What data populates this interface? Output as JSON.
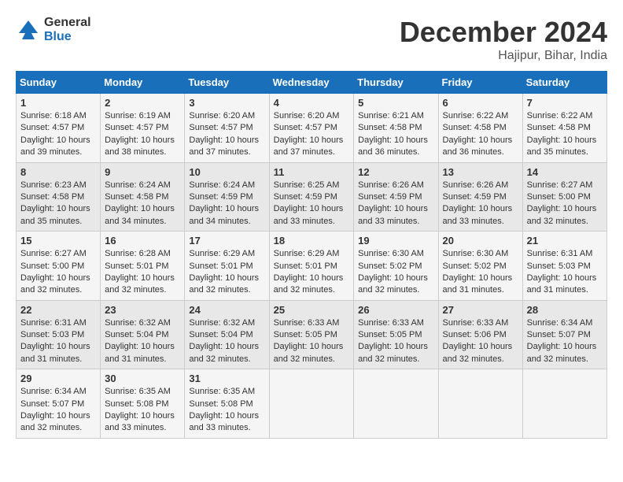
{
  "header": {
    "logo_general": "General",
    "logo_blue": "Blue",
    "main_title": "December 2024",
    "subtitle": "Hajipur, Bihar, India"
  },
  "weekdays": [
    "Sunday",
    "Monday",
    "Tuesday",
    "Wednesday",
    "Thursday",
    "Friday",
    "Saturday"
  ],
  "weeks": [
    [
      {
        "day": "1",
        "sunrise": "6:18 AM",
        "sunset": "4:57 PM",
        "daylight": "10 hours and 39 minutes."
      },
      {
        "day": "2",
        "sunrise": "6:19 AM",
        "sunset": "4:57 PM",
        "daylight": "10 hours and 38 minutes."
      },
      {
        "day": "3",
        "sunrise": "6:20 AM",
        "sunset": "4:57 PM",
        "daylight": "10 hours and 37 minutes."
      },
      {
        "day": "4",
        "sunrise": "6:20 AM",
        "sunset": "4:57 PM",
        "daylight": "10 hours and 37 minutes."
      },
      {
        "day": "5",
        "sunrise": "6:21 AM",
        "sunset": "4:58 PM",
        "daylight": "10 hours and 36 minutes."
      },
      {
        "day": "6",
        "sunrise": "6:22 AM",
        "sunset": "4:58 PM",
        "daylight": "10 hours and 36 minutes."
      },
      {
        "day": "7",
        "sunrise": "6:22 AM",
        "sunset": "4:58 PM",
        "daylight": "10 hours and 35 minutes."
      }
    ],
    [
      {
        "day": "8",
        "sunrise": "6:23 AM",
        "sunset": "4:58 PM",
        "daylight": "10 hours and 35 minutes."
      },
      {
        "day": "9",
        "sunrise": "6:24 AM",
        "sunset": "4:58 PM",
        "daylight": "10 hours and 34 minutes."
      },
      {
        "day": "10",
        "sunrise": "6:24 AM",
        "sunset": "4:59 PM",
        "daylight": "10 hours and 34 minutes."
      },
      {
        "day": "11",
        "sunrise": "6:25 AM",
        "sunset": "4:59 PM",
        "daylight": "10 hours and 33 minutes."
      },
      {
        "day": "12",
        "sunrise": "6:26 AM",
        "sunset": "4:59 PM",
        "daylight": "10 hours and 33 minutes."
      },
      {
        "day": "13",
        "sunrise": "6:26 AM",
        "sunset": "4:59 PM",
        "daylight": "10 hours and 33 minutes."
      },
      {
        "day": "14",
        "sunrise": "6:27 AM",
        "sunset": "5:00 PM",
        "daylight": "10 hours and 32 minutes."
      }
    ],
    [
      {
        "day": "15",
        "sunrise": "6:27 AM",
        "sunset": "5:00 PM",
        "daylight": "10 hours and 32 minutes."
      },
      {
        "day": "16",
        "sunrise": "6:28 AM",
        "sunset": "5:01 PM",
        "daylight": "10 hours and 32 minutes."
      },
      {
        "day": "17",
        "sunrise": "6:29 AM",
        "sunset": "5:01 PM",
        "daylight": "10 hours and 32 minutes."
      },
      {
        "day": "18",
        "sunrise": "6:29 AM",
        "sunset": "5:01 PM",
        "daylight": "10 hours and 32 minutes."
      },
      {
        "day": "19",
        "sunrise": "6:30 AM",
        "sunset": "5:02 PM",
        "daylight": "10 hours and 32 minutes."
      },
      {
        "day": "20",
        "sunrise": "6:30 AM",
        "sunset": "5:02 PM",
        "daylight": "10 hours and 31 minutes."
      },
      {
        "day": "21",
        "sunrise": "6:31 AM",
        "sunset": "5:03 PM",
        "daylight": "10 hours and 31 minutes."
      }
    ],
    [
      {
        "day": "22",
        "sunrise": "6:31 AM",
        "sunset": "5:03 PM",
        "daylight": "10 hours and 31 minutes."
      },
      {
        "day": "23",
        "sunrise": "6:32 AM",
        "sunset": "5:04 PM",
        "daylight": "10 hours and 31 minutes."
      },
      {
        "day": "24",
        "sunrise": "6:32 AM",
        "sunset": "5:04 PM",
        "daylight": "10 hours and 32 minutes."
      },
      {
        "day": "25",
        "sunrise": "6:33 AM",
        "sunset": "5:05 PM",
        "daylight": "10 hours and 32 minutes."
      },
      {
        "day": "26",
        "sunrise": "6:33 AM",
        "sunset": "5:05 PM",
        "daylight": "10 hours and 32 minutes."
      },
      {
        "day": "27",
        "sunrise": "6:33 AM",
        "sunset": "5:06 PM",
        "daylight": "10 hours and 32 minutes."
      },
      {
        "day": "28",
        "sunrise": "6:34 AM",
        "sunset": "5:07 PM",
        "daylight": "10 hours and 32 minutes."
      }
    ],
    [
      {
        "day": "29",
        "sunrise": "6:34 AM",
        "sunset": "5:07 PM",
        "daylight": "10 hours and 32 minutes."
      },
      {
        "day": "30",
        "sunrise": "6:35 AM",
        "sunset": "5:08 PM",
        "daylight": "10 hours and 33 minutes."
      },
      {
        "day": "31",
        "sunrise": "6:35 AM",
        "sunset": "5:08 PM",
        "daylight": "10 hours and 33 minutes."
      },
      null,
      null,
      null,
      null
    ]
  ]
}
